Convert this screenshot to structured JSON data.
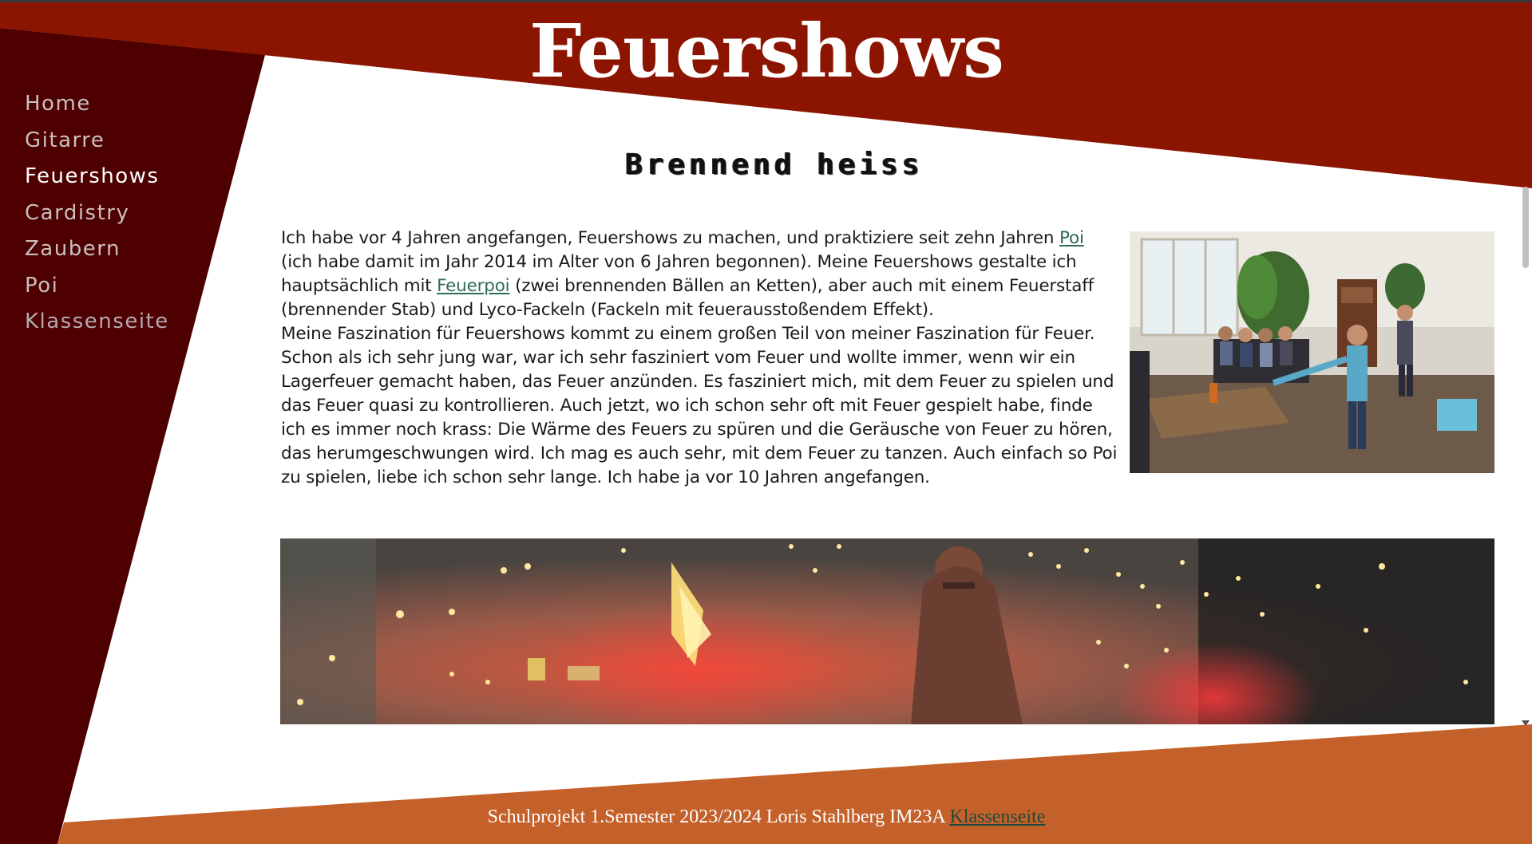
{
  "site": {
    "title": "Feuershows"
  },
  "nav": {
    "items": [
      {
        "label": "Home"
      },
      {
        "label": "Gitarre"
      },
      {
        "label": "Feuershows"
      },
      {
        "label": "Cardistry"
      },
      {
        "label": "Zaubern"
      },
      {
        "label": "Poi"
      },
      {
        "label": "Klassenseite"
      }
    ],
    "active": "Feuershows"
  },
  "main": {
    "subtitle": "Brennend heiss",
    "p1_part1": "Ich habe vor 4 Jahren angefangen, Feuershows zu machen, und praktiziere seit zehn Jahren ",
    "p1_link1": "Poi",
    "p1_part2": " (ich habe damit im Jahr 2014 im Alter von 6 Jahren begonnen). Meine Feuershows gestalte ich hauptsächlich mit ",
    "p1_link2": "Feuerpoi",
    "p1_part3": " (zwei brennenden Bällen an Ketten), aber auch mit einem Feuerstaff (brennender Stab) und Lyco-Fackeln (Fackeln mit feuerausstoßendem Effekt).",
    "p2": "Meine Faszination für Feuershows kommt zu einem großen Teil von meiner Faszination für Feuer. Schon als ich sehr jung war, war ich sehr fasziniert vom Feuer und wollte immer, wenn wir ein Lagerfeuer gemacht haben, das Feuer anzünden. Es fasziniert mich, mit dem Feuer zu spielen und das Feuer quasi zu kontrollieren. Auch jetzt, wo ich schon sehr oft mit Feuer gespielt habe, finde ich es immer noch krass: Die Wärme des Feuers zu spüren und die Geräusche von Feuer zu hören, das herumgeschwungen wird. Ich mag es auch sehr, mit dem Feuer zu tanzen. Auch einfach so Poi zu spielen, liebe ich schon sehr lange. Ich habe ja vor 10 Jahren angefangen."
  },
  "footer": {
    "text": "Schulprojekt 1.Semester 2023/2024 Loris Stahlberg IM23A ",
    "link": "Klassenseite"
  },
  "colors": {
    "header_red": "#8b1500",
    "sidebar_dark": "#4e0000",
    "footer_orange": "#c4612a",
    "link_green": "#2e6b5a"
  }
}
